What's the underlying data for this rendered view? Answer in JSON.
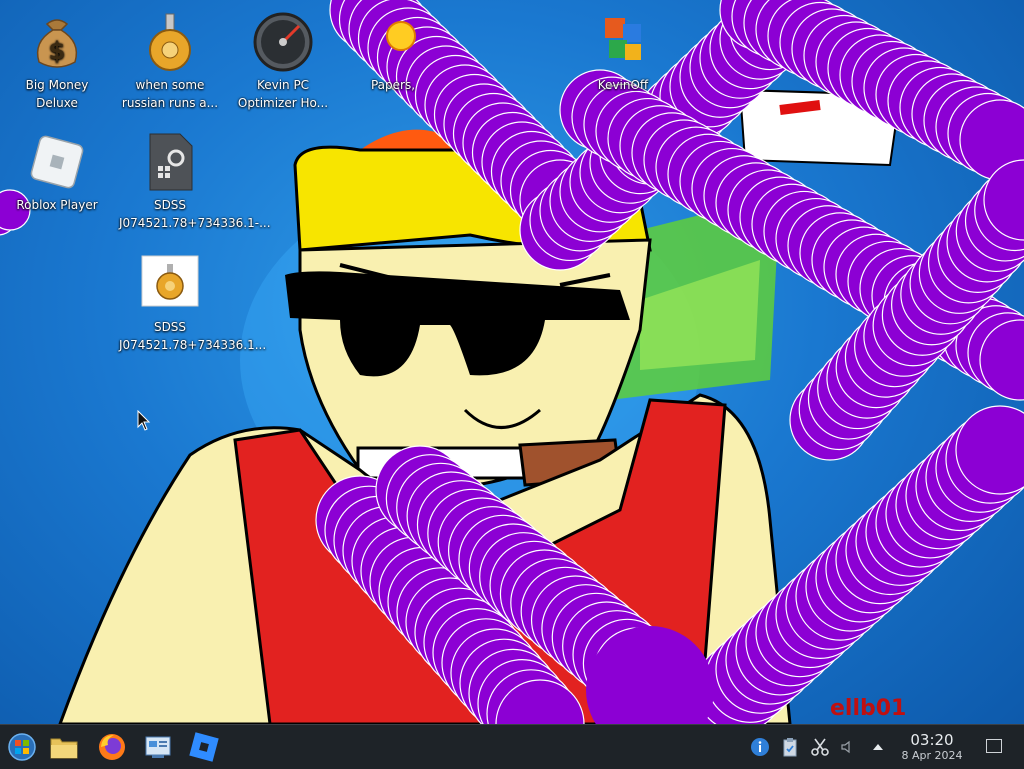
{
  "desktop": {
    "icons": [
      {
        "label": "Big Money Deluxe",
        "icon": "money-bag-icon"
      },
      {
        "label": "when some russian runs a...",
        "icon": "gear-icon"
      },
      {
        "label": "Kevin PC Optimizer Ho...",
        "icon": "speedometer-icon"
      },
      {
        "label": "Papers,",
        "icon": "sun-icon"
      },
      {
        "label": "KevinOff",
        "icon": "office-icon"
      },
      {
        "label": "Roblox Player",
        "icon": "roblox-icon"
      },
      {
        "label": "SDSS J074521.78+734336.1-...",
        "icon": "system-file-icon"
      },
      {
        "label": "SDSS J074521.78+734336.1...",
        "icon": "gear-file-icon"
      }
    ],
    "wallpaper_text": "ellb01",
    "colors": {
      "purple": "#8c00d4",
      "shirt": "#e22220",
      "hat": "#f7e500",
      "skin": "#f9f0b0"
    }
  },
  "taskbar": {
    "start_icon": "start-orb-icon",
    "pinned": [
      {
        "name": "file-explorer",
        "icon": "folder-icon"
      },
      {
        "name": "firefox",
        "icon": "firefox-icon"
      },
      {
        "name": "control-panel",
        "icon": "control-panel-icon"
      },
      {
        "name": "roblox",
        "icon": "roblox-icon"
      }
    ],
    "tray": {
      "icons": [
        "info-icon",
        "clipboard-icon",
        "scissors-icon",
        "volume-icon",
        "chevron-up-icon"
      ],
      "time": "03:20",
      "date": "8 Apr 2024"
    }
  }
}
